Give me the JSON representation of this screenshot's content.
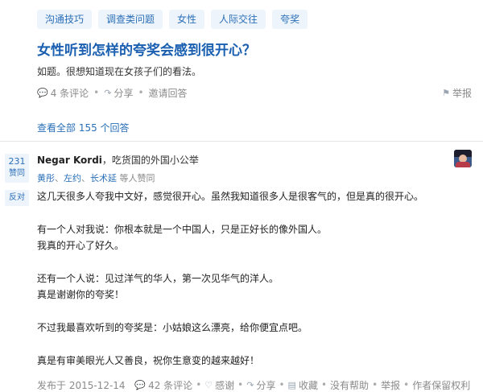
{
  "topics": [
    "沟通技巧",
    "调查类问题",
    "女性",
    "人际交往",
    "夸奖"
  ],
  "question": {
    "title": "女性听到怎样的夸奖会感到很开心？",
    "description": "如题。很想知道现在女孩子们的看法。",
    "comments": "4 条评论",
    "share": "分享",
    "invite": "邀请回答",
    "report": "举报",
    "view_all": "查看全部 155 个回答"
  },
  "answer": {
    "votes": "231",
    "upvote_label": "赞同",
    "downvote_label": "反对",
    "author_name": "Negar Kordi",
    "author_bio": "，吃货国的外国小公举",
    "voters": [
      "黄彤",
      "左约",
      "长术延"
    ],
    "voters_sep": "、",
    "voters_suffix": " 等人赞同",
    "paragraphs": [
      [
        "这几天很多人夸我中文好，感觉很开心。虽然我知道很多人是很客气的，但是真的很开心。"
      ],
      [
        "有一个人对我说：你根本就是一个中国人，只是正好长的像外国人。",
        "我真的开心了好久。"
      ],
      [
        "还有一个人说：见过洋气的华人，第一次见华气的洋人。",
        "真是谢谢你的夸奖！"
      ],
      [
        "不过我最喜欢听到的夸奖是：小姑娘这么漂亮，给你便宜点吧。"
      ],
      [
        "真是有审美眼光人又善良，祝你生意变的越来越好！"
      ]
    ],
    "date": "发布于 2015-12-14",
    "comments": "42 条评论",
    "thanks": "感谢",
    "share": "分享",
    "collect": "收藏",
    "not_helpful": "没有帮助",
    "report": "举报",
    "copyright": "作者保留权利"
  },
  "colors": {
    "link": "#2a6fb8",
    "title": "#1a5fb0",
    "muted": "#8a8a8a",
    "tag_bg": "#eef4fb"
  },
  "icons": {
    "comment": "comment-icon",
    "share": "share-icon",
    "report": "flag-icon",
    "thanks": "heart-icon",
    "collect": "bookmark-icon"
  }
}
